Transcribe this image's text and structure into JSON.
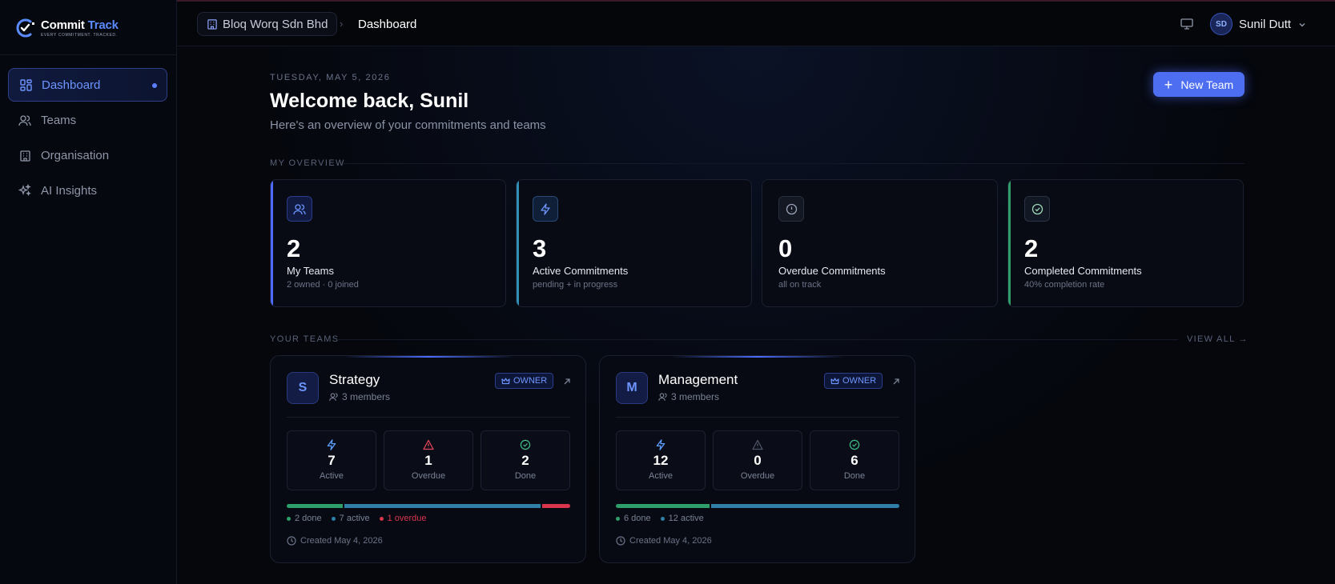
{
  "app": {
    "name_part1": "Commit",
    "name_part2": "Track",
    "tagline": "EVERY COMMITMENT. TRACKED."
  },
  "sidebar": {
    "items": [
      {
        "label": "Dashboard",
        "icon": "dashboard-icon",
        "active": true
      },
      {
        "label": "Teams",
        "icon": "users-icon",
        "active": false
      },
      {
        "label": "Organisation",
        "icon": "building-icon",
        "active": false
      },
      {
        "label": "AI Insights",
        "icon": "sparkles-icon",
        "active": false
      }
    ]
  },
  "header": {
    "org": "Bloq Worq Sdn Bhd",
    "separator": "›",
    "current": "Dashboard",
    "user_initials": "SD",
    "user_name": "Sunil Dutt"
  },
  "page": {
    "date": "TUESDAY, MAY 5, 2026",
    "welcome": "Welcome back, Sunil",
    "subtitle": "Here's an overview of your commitments and teams",
    "new_team_label": "New Team"
  },
  "overview": {
    "label": "MY OVERVIEW",
    "cards": [
      {
        "value": "2",
        "title": "My Teams",
        "sub": "2 owned · 0 joined",
        "icon": "users-icon",
        "accent": "#4f6bff"
      },
      {
        "value": "3",
        "title": "Active Commitments",
        "sub": "pending + in progress",
        "icon": "bolt-icon",
        "accent": "#2f8fb4"
      },
      {
        "value": "0",
        "title": "Overdue Commitments",
        "sub": "all on track",
        "icon": "alert-circle-icon",
        "accent": "#1a2030"
      },
      {
        "value": "2",
        "title": "Completed Commitments",
        "sub": "40% completion rate",
        "icon": "check-circle-icon",
        "accent": "#2e9e6a"
      }
    ]
  },
  "teams": {
    "label": "YOUR TEAMS",
    "view_all": "VIEW ALL →",
    "list": [
      {
        "initial": "S",
        "name": "Strategy",
        "members": "3 members",
        "badge": "OWNER",
        "active": "7",
        "active_label": "Active",
        "overdue": "1",
        "overdue_label": "Overdue",
        "done": "2",
        "done_label": "Done",
        "progress": {
          "done": 2,
          "active": 7,
          "overdue": 1
        },
        "legend": {
          "done": "2 done",
          "active": "7 active",
          "overdue": "1 overdue"
        },
        "created": "Created May 4, 2026"
      },
      {
        "initial": "M",
        "name": "Management",
        "members": "3 members",
        "badge": "OWNER",
        "active": "12",
        "active_label": "Active",
        "overdue": "0",
        "overdue_label": "Overdue",
        "done": "6",
        "done_label": "Done",
        "progress": {
          "done": 6,
          "active": 12,
          "overdue": 0
        },
        "legend": {
          "done": "6 done",
          "active": "12 active"
        },
        "created": "Created May 4, 2026"
      }
    ]
  },
  "colors": {
    "brand": "#5b8cff",
    "done": "#2e9e6a",
    "active": "#2f7fa8",
    "overdue": "#d9364e"
  }
}
